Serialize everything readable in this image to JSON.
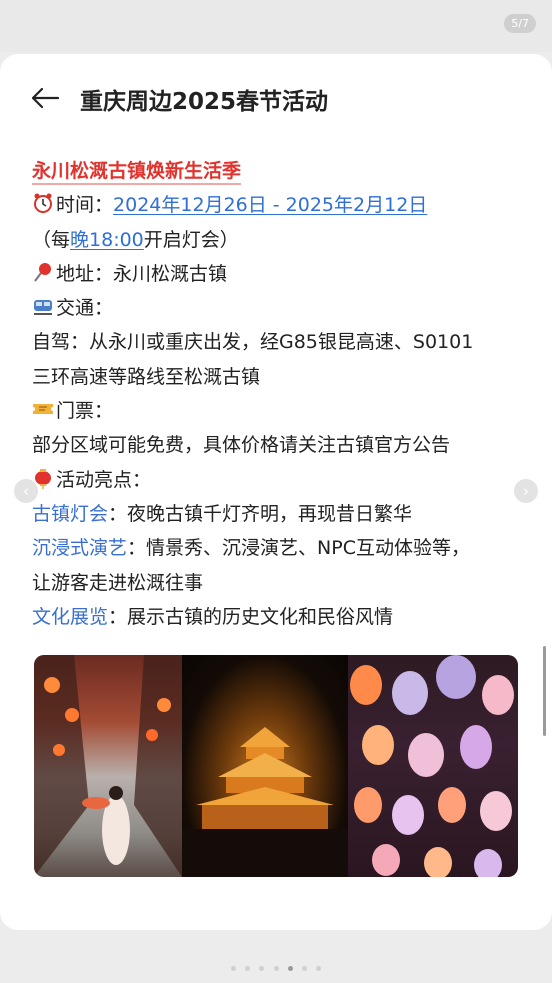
{
  "status": {
    "page_indicator": "5/7"
  },
  "header": {
    "title": "重庆周边2025春节活动"
  },
  "event": {
    "title": "永川松溉古镇焕新生活季",
    "time_label": "时间：",
    "time_value": "2024年12月26日 - 2025年2月12日",
    "time_note_prefix": "（每",
    "time_note_link": "晚18:00",
    "time_note_suffix": "开启灯会）",
    "address_label": "地址：",
    "address_value": "永川松溉古镇",
    "transport_label": "交通：",
    "transport_line1": "自驾：从永川或重庆出发，经G85银昆高速、S0101",
    "transport_line2": "三环高速等路线至松溉古镇",
    "ticket_label": "门票：",
    "ticket_value": "部分区域可能免费，具体价格请关注古镇官方公告",
    "highlights_label": "活动亮点：",
    "highlights": [
      {
        "name": "古镇灯会",
        "sep": "：",
        "desc": "夜晚古镇千灯齐明，再现昔日繁华"
      },
      {
        "name": "沉浸式演艺",
        "sep": "：",
        "desc": "情景秀、沉浸演艺、NPC互动体验等，",
        "desc2": "让游客走进松溉往事"
      },
      {
        "name": "文化展览",
        "sep": "：",
        "desc": "展示古镇的历史文化和民俗风情"
      }
    ]
  },
  "icons": {
    "back": "arrow-left-icon",
    "time": "alarm-clock-icon",
    "address": "pushpin-icon",
    "transport": "tram-icon",
    "ticket": "ticket-icon",
    "highlights": "lantern-icon"
  },
  "colors": {
    "title_red": "#e0332e",
    "link_blue": "#2f6fd6"
  }
}
